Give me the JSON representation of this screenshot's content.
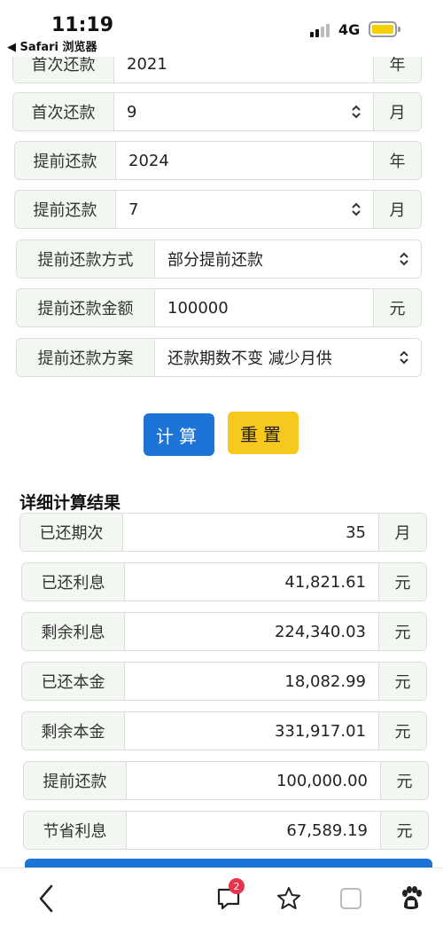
{
  "status_bar": {
    "time": "11:19",
    "back_label": "◀ Safari 浏览器",
    "network": "4G"
  },
  "form": {
    "rows": [
      {
        "label": "首次还款",
        "value": "2021",
        "unit": "年",
        "select": false
      },
      {
        "label": "首次还款",
        "value": "9",
        "unit": "月",
        "select": true
      },
      {
        "label": "提前还款",
        "value": "2024",
        "unit": "年",
        "select": false
      },
      {
        "label": "提前还款",
        "value": "7",
        "unit": "月",
        "select": true
      },
      {
        "label": "提前还款方式",
        "value": "部分提前还款",
        "select": true
      },
      {
        "label": "提前还款金额",
        "value": "100000",
        "unit": "元",
        "select": false
      },
      {
        "label": "提前还款方案",
        "value": "还款期数不变 减少月供",
        "select": true
      }
    ]
  },
  "buttons": {
    "calculate": "计算",
    "reset": "重置"
  },
  "results": {
    "title": "详细计算结果",
    "rows": [
      {
        "label": "已还期次",
        "value": "35",
        "unit": "月"
      },
      {
        "label": "已还利息",
        "value": "41,821.61",
        "unit": "元"
      },
      {
        "label": "剩余利息",
        "value": "224,340.03",
        "unit": "元"
      },
      {
        "label": "已还本金",
        "value": "18,082.99",
        "unit": "元"
      },
      {
        "label": "剩余本金",
        "value": "331,917.01",
        "unit": "元"
      },
      {
        "label": "提前还款",
        "value": "100,000.00",
        "unit": "元"
      },
      {
        "label": "节省利息",
        "value": "67,589.19",
        "unit": "元"
      }
    ]
  },
  "toolbar": {
    "message_badge": "2"
  },
  "colors": {
    "label_bg": "#f2f8f1",
    "primary": "#1e74d6",
    "warning": "#f7c81e",
    "badge": "#e8344b"
  }
}
